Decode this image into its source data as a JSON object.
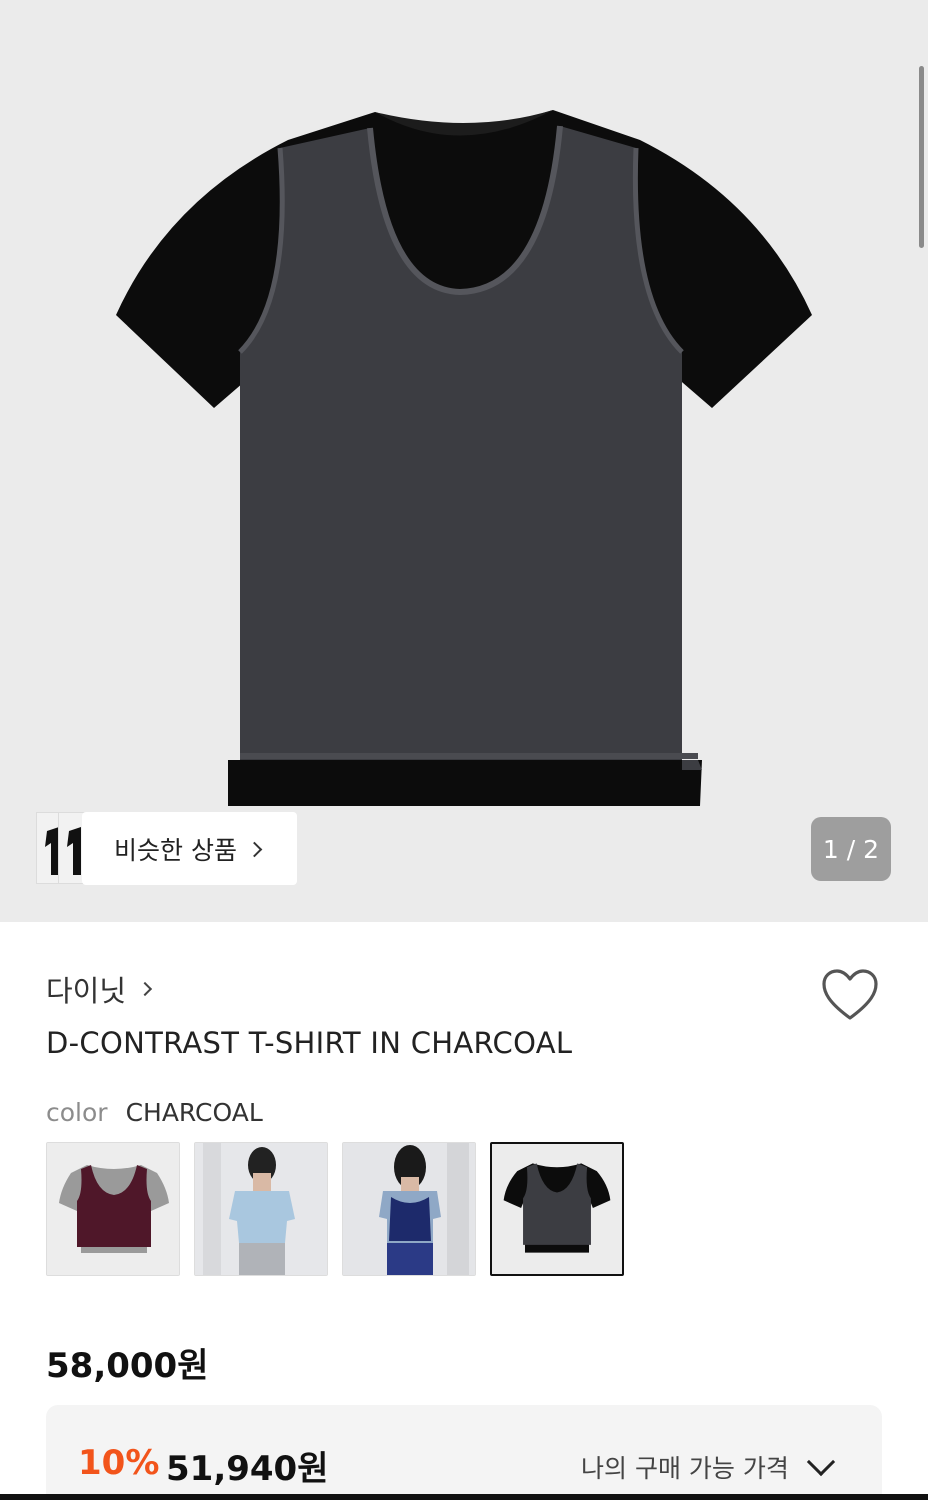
{
  "gallery": {
    "current_page": 1,
    "total_pages": 2,
    "pager_text": "1 / 2",
    "similar_button_label": "비슷한 상품"
  },
  "product": {
    "brand": "다이닛",
    "title": "D-CONTRAST T-SHIRT IN CHARCOAL",
    "color_label": "color",
    "color_value": "CHARCOAL",
    "swatches": [
      {
        "name": "burgundy-grey-swatch",
        "selected": false
      },
      {
        "name": "model-light-blue-swatch",
        "selected": false
      },
      {
        "name": "model-navy-swatch",
        "selected": false
      },
      {
        "name": "charcoal-black-swatch",
        "selected": true
      }
    ],
    "price": "58,000원",
    "discount_percent": "10%",
    "discount_price": "51,940원",
    "my_price_label": "나의 구매 가능 가격"
  },
  "icons": {
    "heart": "heart-outline-icon",
    "chevron_right": "chevron-right-icon",
    "chevron_down": "chevron-down-icon"
  },
  "colors": {
    "accent_discount": "#f2541b",
    "hero_background": "#ebebeb",
    "vest_charcoal": "#3c3d42",
    "tee_black": "#0c0c0c"
  }
}
